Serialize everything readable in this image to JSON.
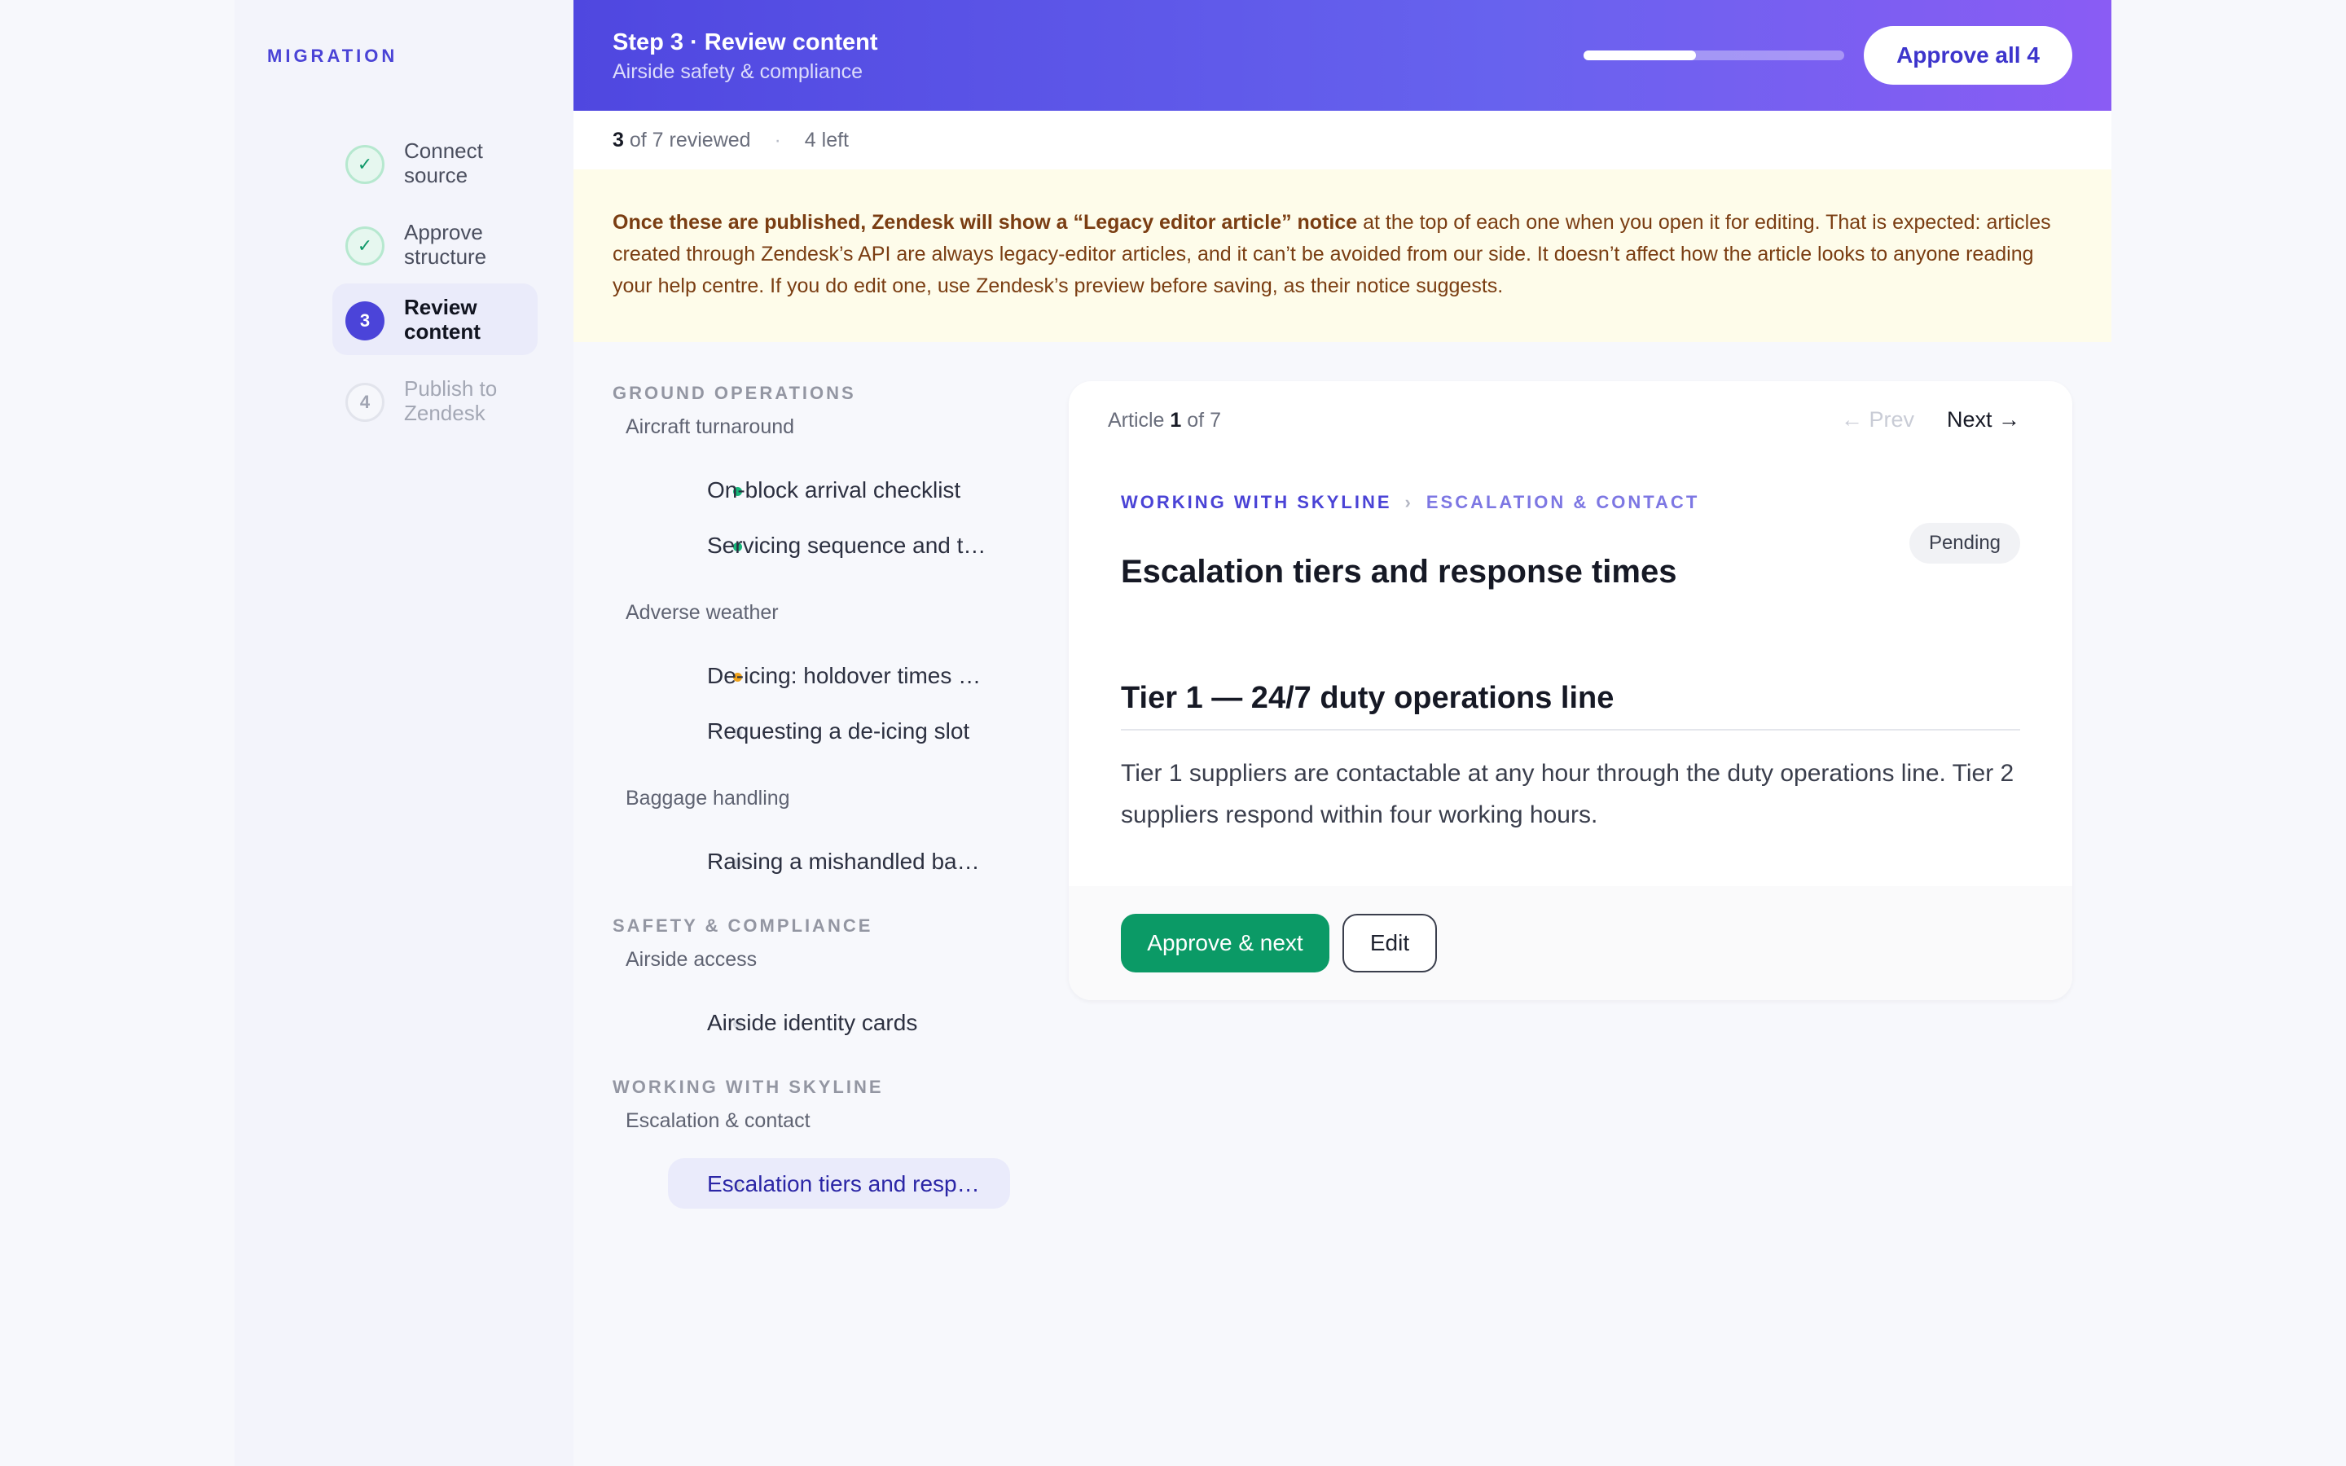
{
  "sidebar": {
    "kicker": "MIGRATION",
    "steps": [
      {
        "num": "✓",
        "label": "Connect source",
        "state": "done"
      },
      {
        "num": "✓",
        "label": "Approve structure",
        "state": "done"
      },
      {
        "num": "3",
        "label": "Review content",
        "state": "current"
      },
      {
        "num": "4",
        "label": "Publish to Zendesk",
        "state": "todo"
      }
    ]
  },
  "header": {
    "title": "Step 3 · Review content",
    "subtitle": "Airside safety & compliance",
    "progress_fraction": 0.43,
    "approve_all_label": "Approve all 4"
  },
  "counts": {
    "reviewed": "3",
    "reviewed_suffix": "of 7 reviewed",
    "separator": "·",
    "left": "4 left"
  },
  "notice": {
    "bold": "Once these are published, Zendesk will show a “Legacy editor article” notice",
    "rest": " at the top of each one when you open it for editing. That is expected: articles created through Zendesk’s API are always legacy-editor articles, and it can’t be avoided from our side. It doesn’t affect how the article looks to anyone reading your help centre. If you do edit one, use Zendesk’s preview before saving, as their notice suggests."
  },
  "tree": {
    "sections": [
      {
        "label": "GROUND OPERATIONS"
      },
      {
        "label": "SAFETY & COMPLIANCE"
      },
      {
        "label": "WORKING WITH SKYLINE"
      }
    ],
    "groups": [
      {
        "label": "Aircraft turnaround"
      },
      {
        "label": "Adverse weather"
      },
      {
        "label": "Baggage handling"
      },
      {
        "label": "Airside access"
      },
      {
        "label": "Escalation & contact"
      }
    ],
    "items": [
      {
        "text": "On-block arrival checklist",
        "status": "green"
      },
      {
        "text": "Servicing sequence and t…",
        "status": "green"
      },
      {
        "text": "De-icing: holdover times …",
        "status": "orange"
      },
      {
        "text": "Requesting a de-icing slot",
        "status": "gray"
      },
      {
        "text": "Raising a mishandled ba…",
        "status": "gray"
      },
      {
        "text": "Airside identity cards",
        "status": "gray"
      },
      {
        "text": "Escalation tiers and resp…",
        "status": "gray",
        "selected": true
      }
    ]
  },
  "article": {
    "count_prefix": "Article",
    "count_current": "1",
    "count_suffix": "of 7",
    "prev_label": "← Prev",
    "next_label": "Next →",
    "crumb_1": "WORKING WITH SKYLINE",
    "crumb_sep": "›",
    "crumb_2": "ESCALATION & CONTACT",
    "status": "Pending",
    "title": "Escalation tiers and response times",
    "heading": "Tier 1 — 24/7 duty operations line",
    "body": "Tier 1 suppliers are contactable at any hour through the duty operations line. Tier 2 suppliers respond within four working hours.",
    "approve_next_label": "Approve & next",
    "edit_label": "Edit"
  },
  "colors": {
    "accent": "#4b44d9",
    "success": "#0b9a66",
    "warning": "#f0a31c",
    "notice_bg": "#fefcea"
  }
}
